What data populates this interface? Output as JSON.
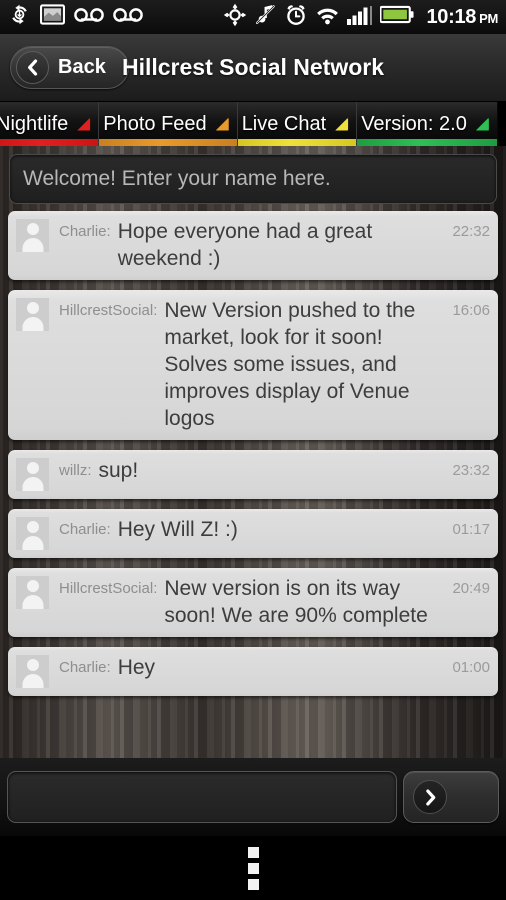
{
  "statusbar": {
    "time": "10:18",
    "ampm": "PM",
    "icons": [
      {
        "name": "sync-icon"
      },
      {
        "name": "screenshot-icon"
      },
      {
        "name": "voicemail-icon-1"
      },
      {
        "name": "voicemail-icon-2"
      },
      {
        "name": "gps-icon"
      },
      {
        "name": "music-muted-icon"
      },
      {
        "name": "alarm-clock-icon"
      },
      {
        "name": "wifi-icon"
      },
      {
        "name": "cellular-signal-icon"
      },
      {
        "name": "battery-icon"
      }
    ],
    "battery_color": "#8ec640"
  },
  "titlebar": {
    "back_label": "Back",
    "title": "Hillcrest Social Network"
  },
  "tabs": [
    {
      "label": "Nightlife",
      "color": "#cc1414",
      "mark_color": "#e02020"
    },
    {
      "label": "Photo Feed",
      "color": "#c9801f",
      "mark_color": "#e89a2c"
    },
    {
      "label": "Live Chat",
      "color": "#d6c723",
      "mark_color": "#efe03a"
    },
    {
      "label": "Version: 2.0",
      "color": "#1f9c42",
      "mark_color": "#2fbf55"
    }
  ],
  "name_field": {
    "placeholder": "Welcome! Enter your name here.",
    "value": ""
  },
  "messages": [
    {
      "user": "Charlie:",
      "text": "Hope everyone had a great weekend :)",
      "time": "22:32"
    },
    {
      "user": "HillcrestSocial:",
      "text": "New Version pushed to the market, look for it soon! Solves some issues, and improves display of Venue logos",
      "time": "16:06"
    },
    {
      "user": "willz:",
      "text": "sup!",
      "time": "23:32"
    },
    {
      "user": "Charlie:",
      "text": "Hey Will Z! :)",
      "time": "01:17"
    },
    {
      "user": "HillcrestSocial:",
      "text": "New version is on its way soon! We are 90% complete",
      "time": "20:49"
    },
    {
      "user": "Charlie:",
      "text": "Hey",
      "time": "01:00"
    }
  ],
  "composer": {
    "placeholder": "",
    "value": "",
    "send_icon": "chevron-right-icon"
  },
  "navbar": {
    "menu_icon": "overflow-menu-icon"
  }
}
